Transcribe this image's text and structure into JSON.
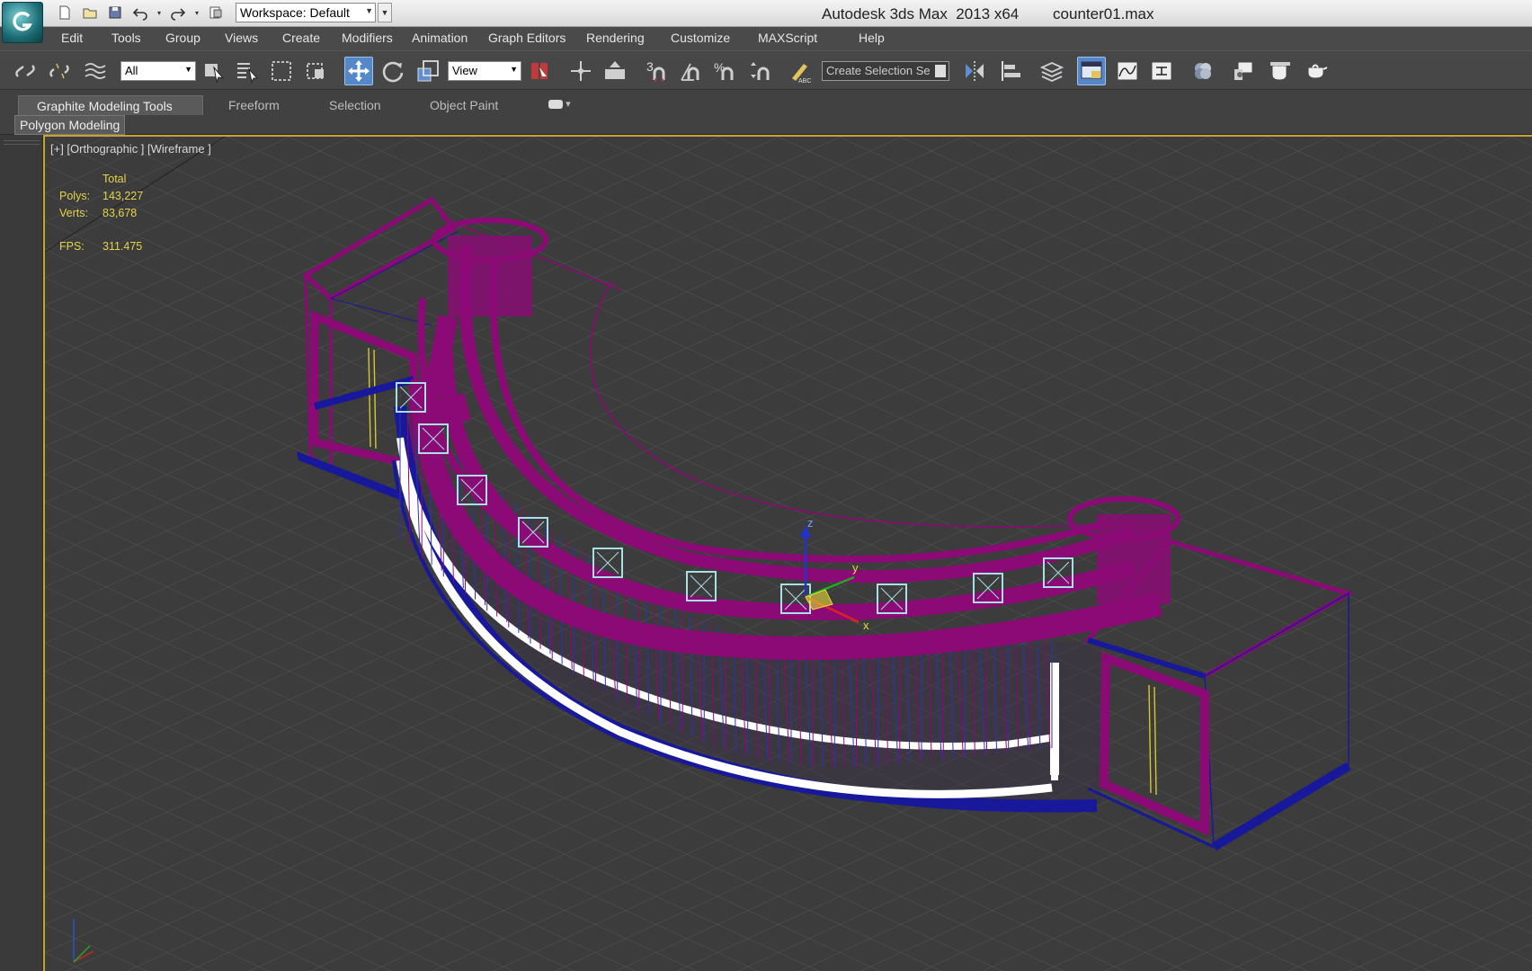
{
  "title": {
    "app_name": "Autodesk 3ds Max  2013 x64",
    "file_name": "counter01.max",
    "workspace": "Workspace: Default"
  },
  "menu": [
    {
      "label": "Edit"
    },
    {
      "label": "Tools"
    },
    {
      "label": "Group"
    },
    {
      "label": "Views"
    },
    {
      "label": "Create"
    },
    {
      "label": "Modifiers"
    },
    {
      "label": "Animation"
    },
    {
      "label": "Graph Editors"
    },
    {
      "label": "Rendering"
    },
    {
      "label": "Customize"
    },
    {
      "label": "MAXScript"
    },
    {
      "label": "Help"
    }
  ],
  "toolbar": {
    "selection_filter": "All",
    "reference_coord": "View",
    "named_selection": "Create Selection Se",
    "snap_3d_label": "3",
    "percent_snap_label": "%"
  },
  "ribbon": {
    "tabs": [
      {
        "label": "Graphite Modeling Tools"
      },
      {
        "label": "Freeform"
      },
      {
        "label": "Selection"
      },
      {
        "label": "Object Paint"
      }
    ],
    "sub_panel": "Polygon Modeling"
  },
  "viewport": {
    "label": "[+] [Orthographic ] [Wireframe ]",
    "stats": {
      "header": "Total",
      "polys_label": "Polys:",
      "polys_value": "143,227",
      "verts_label": "Verts:",
      "verts_value": "83,678",
      "fps_label": "FPS:",
      "fps_value": "311.475"
    },
    "gizmo": {
      "z": "z",
      "y": "y",
      "x": "x"
    },
    "colors": {
      "grid": "#4d4d4d",
      "magenta": "#8b0a75",
      "blue": "#18189a",
      "white": "#ffffff",
      "cyan": "#a9e0e6",
      "yellow": "#d6c633"
    }
  }
}
